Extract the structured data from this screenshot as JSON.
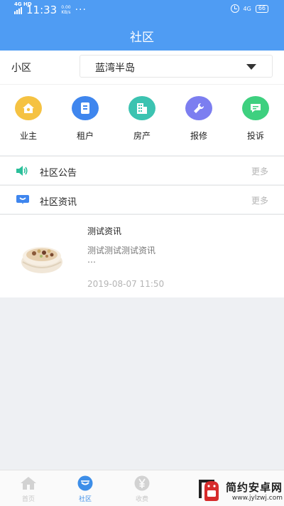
{
  "status_bar": {
    "network": "4G HD",
    "time": "11:33",
    "speed_value": "0.00",
    "speed_unit": "KB/s",
    "dots": "···",
    "mobile": "4G",
    "battery": "66"
  },
  "header": {
    "title": "社区"
  },
  "community": {
    "label": "小区",
    "selected": "蓝湾半岛"
  },
  "shortcuts": [
    {
      "label": "业主",
      "icon": "home-icon",
      "color": "#f5c242"
    },
    {
      "label": "租户",
      "icon": "document-icon",
      "color": "#3f86ee"
    },
    {
      "label": "房产",
      "icon": "building-icon",
      "color": "#3cc3b1"
    },
    {
      "label": "报修",
      "icon": "wrench-icon",
      "color": "#7c7ef0"
    },
    {
      "label": "投诉",
      "icon": "chat-icon",
      "color": "#3ed07f"
    }
  ],
  "announcements": {
    "title": "社区公告",
    "more": "更多",
    "icon": "speaker-icon"
  },
  "news_section": {
    "title": "社区资讯",
    "more": "更多",
    "icon": "message-icon"
  },
  "news_items": [
    {
      "title": "测试资讯",
      "summary": "测试测试测试资讯",
      "ellipsis": "…",
      "time": "2019-08-07 11:50"
    }
  ],
  "bottom_nav": [
    {
      "label": "首页",
      "icon": "home-icon",
      "active": false
    },
    {
      "label": "社区",
      "icon": "community-icon",
      "active": true
    },
    {
      "label": "收费",
      "icon": "yuan-icon",
      "active": false
    }
  ],
  "watermark": {
    "name": "简约安卓网",
    "url": "www.jylzwj.com"
  },
  "colors": {
    "primary": "#4f9cf3",
    "active_tab": "#3d8ee8"
  }
}
